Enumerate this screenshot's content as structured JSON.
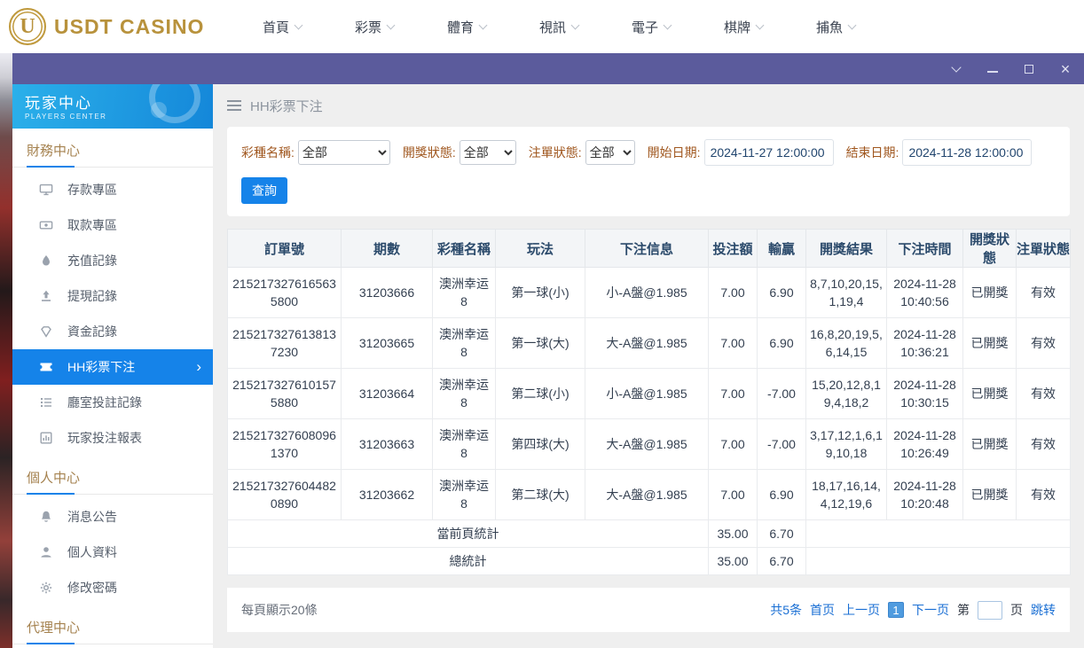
{
  "colors": {
    "accent_blue": "#1583e9",
    "frame_purple": "#5b5b9c",
    "sidebar_header_blue": "#1a9ce2",
    "gold_brand": "#b8923c",
    "section_title_tan": "#a5824f",
    "filter_label_brown": "#a0571f",
    "table_header_navy": "#2b4a6b",
    "link_blue": "#1a6fd4"
  },
  "icons": {
    "hamburger": "css-3-lines",
    "chevron-down": "css-rotated-border",
    "chevron-right": "›",
    "minimize": "css-line",
    "maximize": "css-box",
    "close": "×"
  },
  "topnav": {
    "logo_text": "USDT CASINO",
    "logo_letter": "U",
    "items": [
      {
        "label": "首頁"
      },
      {
        "label": "彩票"
      },
      {
        "label": "體育"
      },
      {
        "label": "視訊"
      },
      {
        "label": "電子"
      },
      {
        "label": "棋牌"
      },
      {
        "label": "捕魚"
      }
    ]
  },
  "sidebar": {
    "header": {
      "title": "玩家中心",
      "subtitle": "PLAYERS CENTER"
    },
    "sections": [
      {
        "title": "財務中心",
        "items": [
          {
            "label": "存款專區"
          },
          {
            "label": "取款專區"
          },
          {
            "label": "充值記錄"
          },
          {
            "label": "提現記錄"
          },
          {
            "label": "資金記錄"
          },
          {
            "label": "HH彩票下注"
          },
          {
            "label": "廳室投註記錄"
          },
          {
            "label": "玩家投注報表"
          }
        ]
      },
      {
        "title": "個人中心",
        "items": [
          {
            "label": "消息公告"
          },
          {
            "label": "個人資料"
          },
          {
            "label": "修改密碼"
          }
        ]
      },
      {
        "title": "代理中心",
        "items": []
      }
    ]
  },
  "page": {
    "header_title": "HH彩票下注",
    "filters": {
      "lottery_label": "彩種名稱:",
      "lottery_value": "全部",
      "draw_status_label": "開獎狀態:",
      "draw_status_value": "全部",
      "order_status_label": "注單狀態:",
      "order_status_value": "全部",
      "start_label": "開始日期:",
      "start_value": "2024-11-27 12:00:00",
      "end_label": "結束日期:",
      "end_value": "2024-11-28 12:00:00",
      "search_label": "查詢"
    },
    "table": {
      "headers": [
        "訂單號",
        "期數",
        "彩種名稱",
        "玩法",
        "下注信息",
        "投注額",
        "輸贏",
        "開獎結果",
        "下注時間",
        "開獎狀態",
        "注單狀態"
      ],
      "rows": [
        {
          "order_no": "2152173276165635800",
          "period": "31203666",
          "lottery": "澳洲幸运8",
          "play": "第一球(小)",
          "bet_info": "小-A盤@1.985",
          "amount": "7.00",
          "win": "6.90",
          "result": "8,7,10,20,15,1,19,4",
          "time": "2024-11-28 10:40:56",
          "draw_status": "已開獎",
          "order_status": "有效"
        },
        {
          "order_no": "2152173276138137230",
          "period": "31203665",
          "lottery": "澳洲幸运8",
          "play": "第一球(大)",
          "bet_info": "大-A盤@1.985",
          "amount": "7.00",
          "win": "6.90",
          "result": "16,8,20,19,5,6,14,15",
          "time": "2024-11-28 10:36:21",
          "draw_status": "已開獎",
          "order_status": "有效"
        },
        {
          "order_no": "2152173276101575880",
          "period": "31203664",
          "lottery": "澳洲幸运8",
          "play": "第二球(小)",
          "bet_info": "小-A盤@1.985",
          "amount": "7.00",
          "win": "-7.00",
          "result": "15,20,12,8,19,4,18,2",
          "time": "2024-11-28 10:30:15",
          "draw_status": "已開獎",
          "order_status": "有效"
        },
        {
          "order_no": "2152173276080961370",
          "period": "31203663",
          "lottery": "澳洲幸运8",
          "play": "第四球(大)",
          "bet_info": "大-A盤@1.985",
          "amount": "7.00",
          "win": "-7.00",
          "result": "3,17,12,1,6,19,10,18",
          "time": "2024-11-28 10:26:49",
          "draw_status": "已開獎",
          "order_status": "有效"
        },
        {
          "order_no": "2152173276044820890",
          "period": "31203662",
          "lottery": "澳洲幸运8",
          "play": "第二球(大)",
          "bet_info": "大-A盤@1.985",
          "amount": "7.00",
          "win": "6.90",
          "result": "18,17,16,14,4,12,19,6",
          "time": "2024-11-28 10:20:48",
          "draw_status": "已開獎",
          "order_status": "有效"
        }
      ],
      "page_total": {
        "label": "當前頁統計",
        "amount": "35.00",
        "win": "6.70"
      },
      "grand_total": {
        "label": "總統計",
        "amount": "35.00",
        "win": "6.70"
      }
    },
    "pagination": {
      "page_size_text": "每頁顯示20條",
      "total_text": "共5条",
      "first": "首页",
      "prev": "上一页",
      "current": "1",
      "next": "下一页",
      "jump_prefix": "第",
      "jump_suffix": "页",
      "jump_label": "跳转"
    }
  }
}
